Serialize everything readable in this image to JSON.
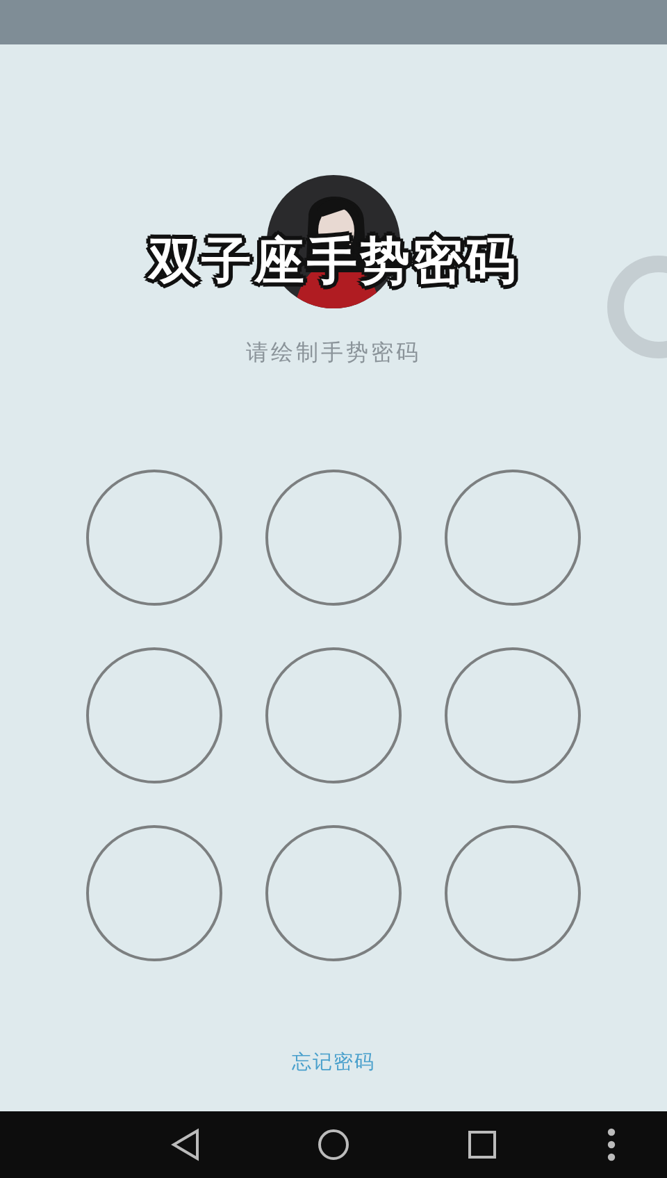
{
  "title": "双子座手势密码",
  "prompt": "请绘制手势密码",
  "pattern_dots": [
    {
      "selected": false
    },
    {
      "selected": false
    },
    {
      "selected": false
    },
    {
      "selected": false
    },
    {
      "selected": false
    },
    {
      "selected": false
    },
    {
      "selected": false
    },
    {
      "selected": false
    },
    {
      "selected": false
    }
  ],
  "forgot_link": "忘记密码"
}
